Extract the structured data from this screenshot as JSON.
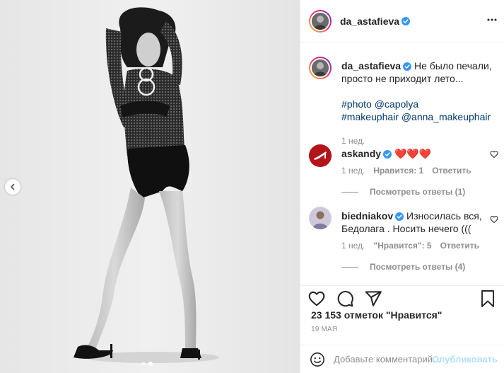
{
  "post": {
    "author": "da_astafieva",
    "more_icon": "more-horizontal-icon",
    "verified_icon": "verified-badge-icon"
  },
  "caption": {
    "username": "da_astafieva",
    "text": "Не было печали, просто не приходит лето...",
    "tags_line1": "#photo @capolya",
    "tags_line2": "#makeuphair @anna_makeuphair",
    "time": "1 нед."
  },
  "comments": [
    {
      "username": "askandy",
      "text": "❤️❤️❤️",
      "time": "1 нед.",
      "likes": "Нравится: 1",
      "reply": "Ответить",
      "view_replies": "Посмотреть ответы (1)"
    },
    {
      "username": "biedniakov",
      "text": "Износилась вся, Бедолага . Носить нечего (((",
      "time": "1 нед.",
      "likes": "\"Нравится\": 5",
      "reply": "Ответить",
      "view_replies": "Посмотреть ответы (4)"
    }
  ],
  "actions": {
    "like_icon": "heart-icon",
    "comment_icon": "comment-icon",
    "share_icon": "share-icon",
    "save_icon": "bookmark-icon"
  },
  "likes_text": "23 153 отметок \"Нравится\"",
  "date": "19 МАЯ",
  "add_comment": {
    "placeholder": "Добавьте комментарий...",
    "publish_label": "Опубликовать",
    "emoji_icon": "emoji-icon"
  },
  "carousel": {
    "prev_icon": "chevron-left-icon",
    "slide_count": 2,
    "active_slide": 2
  },
  "colors": {
    "link": "#00376b",
    "muted": "#8e8e8e",
    "publish_disabled": "#b2dffc",
    "verified": "#3897f0",
    "heart": "#ed4956"
  }
}
